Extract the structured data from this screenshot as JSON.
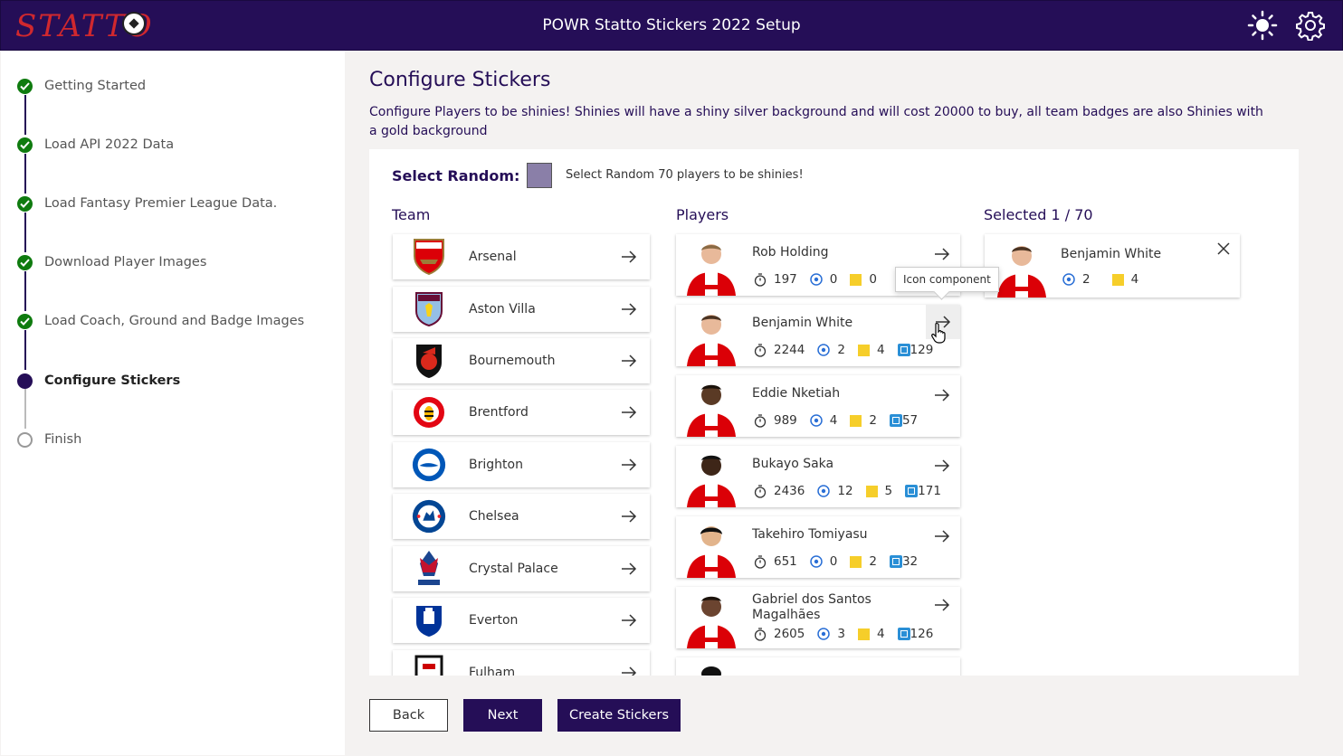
{
  "app": {
    "logo_text": "STATTO",
    "title": "POWR Statto Stickers 2022 Setup",
    "theme_icon": "sun-icon",
    "settings_icon": "gear-icon"
  },
  "steps": [
    {
      "label": "Getting Started",
      "status": "complete"
    },
    {
      "label": "Load API 2022 Data",
      "status": "complete"
    },
    {
      "label": "Load Fantasy Premier League Data.",
      "status": "complete"
    },
    {
      "label": "Download Player Images",
      "status": "complete"
    },
    {
      "label": "Load Coach, Ground and Badge Images",
      "status": "complete"
    },
    {
      "label": "Configure Stickers",
      "status": "current"
    },
    {
      "label": "Finish",
      "status": "pending"
    }
  ],
  "page": {
    "title": "Configure Stickers",
    "description": "Configure Players to be shinies! Shinies will have a shiny silver background and will cost 20000 to buy, all team badges are also Shinies with a gold background"
  },
  "select_random": {
    "label": "Select Random:",
    "text": "Select Random 70 players to be shinies!"
  },
  "columns": {
    "team": "Team",
    "players": "Players",
    "selected": "Selected 1 / 70"
  },
  "teams": [
    "Arsenal",
    "Aston Villa",
    "Bournemouth",
    "Brentford",
    "Brighton",
    "Chelsea",
    "Crystal Palace",
    "Everton",
    "Fulham"
  ],
  "players": [
    {
      "name": "Rob Holding",
      "minutes": "197",
      "goals": "0",
      "cards": "0",
      "points": ""
    },
    {
      "name": "Benjamin White",
      "minutes": "2244",
      "goals": "2",
      "cards": "4",
      "points": "129"
    },
    {
      "name": "Eddie Nketiah",
      "minutes": "989",
      "goals": "4",
      "cards": "2",
      "points": "57"
    },
    {
      "name": "Bukayo Saka",
      "minutes": "2436",
      "goals": "12",
      "cards": "5",
      "points": "171"
    },
    {
      "name": "Takehiro Tomiyasu",
      "minutes": "651",
      "goals": "0",
      "cards": "2",
      "points": "32"
    },
    {
      "name": "Gabriel dos Santos Magalhães",
      "minutes": "2605",
      "goals": "3",
      "cards": "4",
      "points": "126"
    }
  ],
  "selected": [
    {
      "name": "Benjamin White",
      "goals": "2",
      "cards": "4"
    }
  ],
  "tooltip": "Icon component",
  "buttons": {
    "back": "Back",
    "next": "Next",
    "create": "Create Stickers"
  },
  "colors": {
    "brand": "#250e57",
    "success": "#0f7b0f",
    "card_yellow": "#f6ce2a",
    "points_blue": "#2a8fd6",
    "arsenal_red": "#db0007"
  }
}
